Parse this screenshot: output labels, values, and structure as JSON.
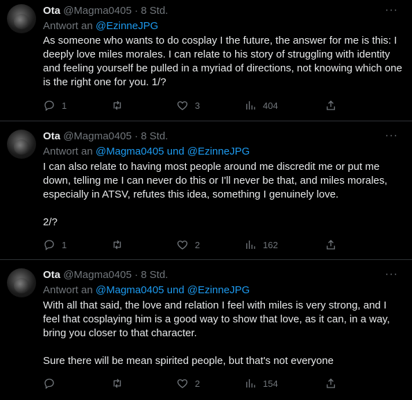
{
  "tweets": [
    {
      "name": "Ota",
      "handle": "@Magma0405",
      "dot": "·",
      "time": "8 Std.",
      "reply_prefix": "Antwort an",
      "reply_links": "@EzinneJPG",
      "paragraphs": [
        "As someone who wants to do cosplay I the future, the answer for me is this: I deeply love miles morales. I can relate to his story of struggling with identity and feeling yourself be pulled in a myriad of directions, not knowing which one is the right one for you. 1/?"
      ],
      "replies": "1",
      "retweets": "",
      "likes": "3",
      "views": "404"
    },
    {
      "name": "Ota",
      "handle": "@Magma0405",
      "dot": "·",
      "time": "8 Std.",
      "reply_prefix": "Antwort an",
      "reply_links": "@Magma0405 und @EzinneJPG",
      "paragraphs": [
        "I can also relate to having most people around me discredit me or put me down, telling me I can never do this or I'll never be that, and miles morales, especially in ATSV, refutes this idea, something I genuinely love.",
        "2/?"
      ],
      "replies": "1",
      "retweets": "",
      "likes": "2",
      "views": "162"
    },
    {
      "name": "Ota",
      "handle": "@Magma0405",
      "dot": "·",
      "time": "8 Std.",
      "reply_prefix": "Antwort an",
      "reply_links": "@Magma0405 und @EzinneJPG",
      "paragraphs": [
        "With all that said, the love and relation I feel with miles is very strong, and I feel that cosplaying him is a good way to show that love, as it can, in a way, bring you closer to that character.",
        "Sure there will be mean spirited people, but that's not everyone"
      ],
      "replies": "",
      "retweets": "",
      "likes": "2",
      "views": "154"
    }
  ],
  "colors": {
    "background": "#000000",
    "text": "#e7e9ea",
    "muted": "#71767b",
    "link": "#1d9bf0",
    "divider": "#2f3336"
  },
  "icons": {
    "reply": "reply-icon",
    "retweet": "retweet-icon",
    "like": "heart-icon",
    "views": "views-icon",
    "share": "share-icon",
    "more": "more-icon"
  }
}
